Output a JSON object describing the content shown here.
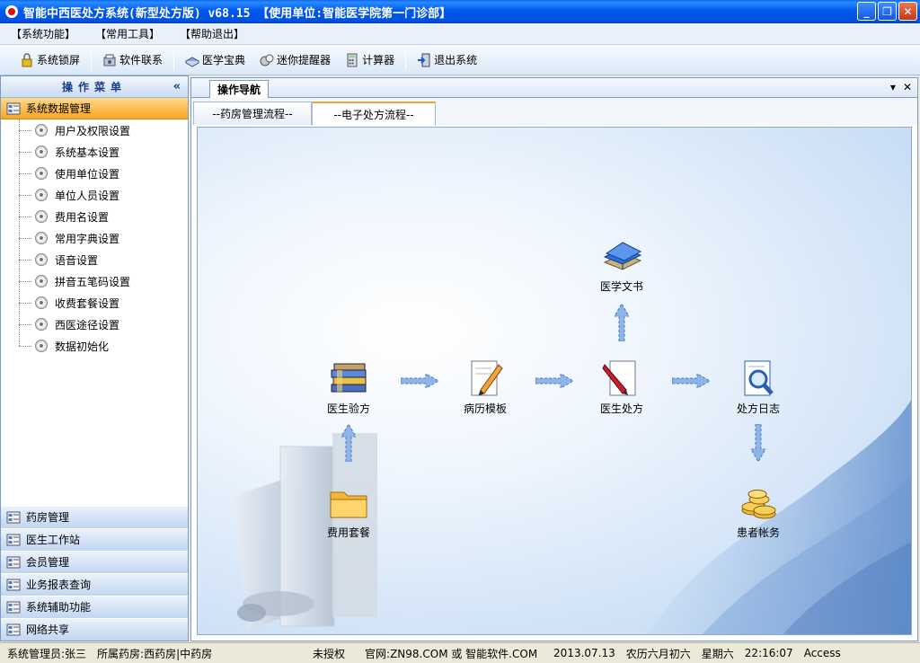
{
  "window": {
    "title": "智能中西医处方系统(新型处方版) v68.15 【使用单位:智能医学院第一门诊部】"
  },
  "menu": [
    "【系统功能】",
    "【常用工具】",
    "【帮助退出】"
  ],
  "toolbar": [
    {
      "label": "系统锁屏",
      "icon": "lock-icon"
    },
    {
      "label": "软件联系",
      "icon": "contact-icon"
    },
    {
      "label": "医学宝典",
      "icon": "book-icon"
    },
    {
      "label": "迷你提醒器",
      "icon": "reminder-icon"
    },
    {
      "label": "计算器",
      "icon": "calculator-icon"
    },
    {
      "label": "退出系统",
      "icon": "exit-icon"
    }
  ],
  "left_panel": {
    "title": "操作菜单",
    "collapse": "«",
    "active_group": "系统数据管理",
    "items": [
      "用户及权限设置",
      "系统基本设置",
      "使用单位设置",
      "单位人员设置",
      "费用名设置",
      "常用字典设置",
      "语音设置",
      "拼音五笔码设置",
      "收费套餐设置",
      "西医途径设置",
      "数据初始化"
    ],
    "other_groups": [
      "药房管理",
      "医生工作站",
      "会员管理",
      "业务报表查询",
      "系统辅助功能",
      "网络共享"
    ]
  },
  "right_panel": {
    "tab": "操作导航",
    "tab_controls": [
      "▾",
      "✕"
    ],
    "subtabs": [
      "--药房管理流程--",
      "--电子处方流程--"
    ],
    "active_subtab": 1,
    "nodes": {
      "medical_books": "医学文书",
      "doctor_check": "医生验方",
      "record_template": "病历模板",
      "doctor_prescription": "医生处方",
      "prescription_log": "处方日志",
      "fee_package": "费用套餐",
      "patient_account": "患者帐务"
    }
  },
  "status": {
    "admin": "系统管理员:张三",
    "pharmacy": "所属药房:西药房|中药房",
    "license": "未授权",
    "website": "官网:ZN98.COM 或 智能软件.COM",
    "date": "2013.07.13",
    "lunar": "农历六月初六",
    "weekday": "星期六",
    "time": "22:16:07",
    "db": "Access"
  }
}
